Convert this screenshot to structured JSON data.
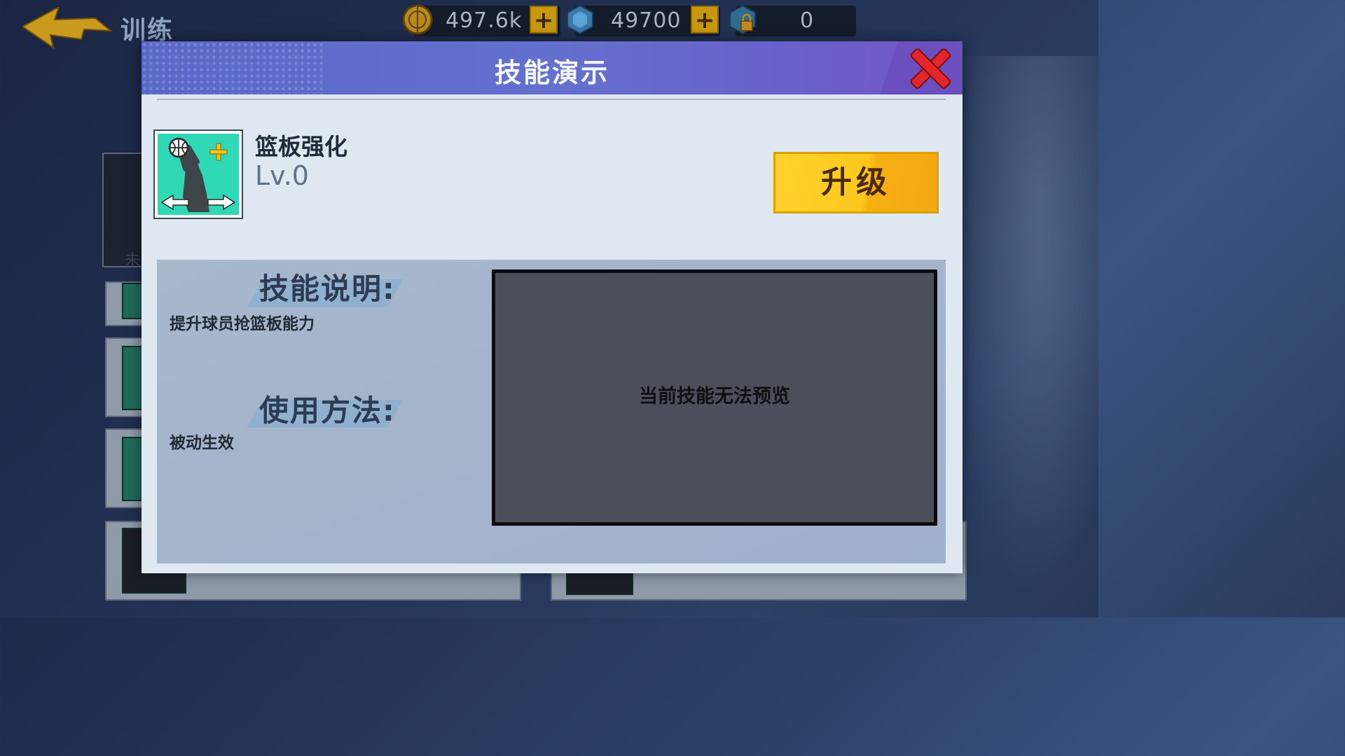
{
  "topbar": {
    "title": "训练",
    "coins": "497.6k",
    "gems": "49700",
    "tickets": "0",
    "plus_symbol": "+"
  },
  "background": {
    "list_label": "未"
  },
  "modal": {
    "title": "技能演示",
    "skill": {
      "name": "篮板强化",
      "level": "Lv.0",
      "icon": "rebound-boost-icon"
    },
    "upgrade_label": "升级",
    "description_heading": "技能说明:",
    "description_text": "提升球员抢篮板能力",
    "usage_heading": "使用方法:",
    "usage_text": "被动生效",
    "preview_message": "当前技能无法预览"
  },
  "colors": {
    "header": "#6470cf",
    "close": "#e3262a",
    "upgrade": "#fcc81c",
    "icon_bg": "#2fd9b5"
  }
}
